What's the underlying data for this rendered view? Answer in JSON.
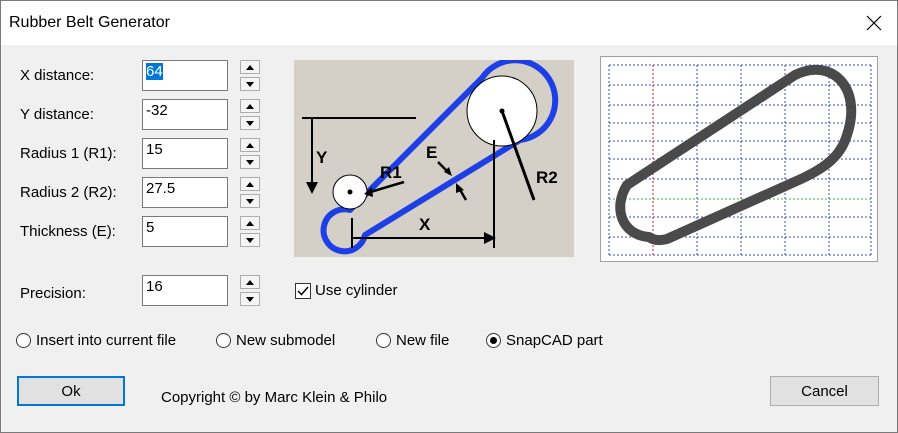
{
  "window": {
    "title": "Rubber Belt Generator"
  },
  "fields": [
    {
      "label": "X distance:",
      "value": "64"
    },
    {
      "label": "Y distance:",
      "value": "-32"
    },
    {
      "label": "Radius 1 (R1):",
      "value": "15"
    },
    {
      "label": "Radius 2 (R2):",
      "value": "27.5"
    },
    {
      "label": "Thickness (E):",
      "value": "5"
    }
  ],
  "precision": {
    "label": "Precision:",
    "value": "16"
  },
  "use_cylinder": {
    "label": "Use cylinder",
    "checked": true
  },
  "diagram": {
    "y_label": "Y",
    "x_label": "X",
    "r1_label": "R1",
    "r2_label": "R2",
    "e_label": "E"
  },
  "output_options": [
    {
      "label": "Insert into current file",
      "selected": false
    },
    {
      "label": "New submodel",
      "selected": false
    },
    {
      "label": "New file",
      "selected": false
    },
    {
      "label": "SnapCAD part",
      "selected": true
    }
  ],
  "buttons": {
    "ok": "Ok",
    "cancel": "Cancel"
  },
  "copyright": "Copyright © by Marc Klein & Philo",
  "colors": {
    "belt_blue": "#1e3fe6",
    "belt_gray": "#4a4a4a",
    "grid": "#3a4fc4",
    "accent": "#0078d7"
  }
}
